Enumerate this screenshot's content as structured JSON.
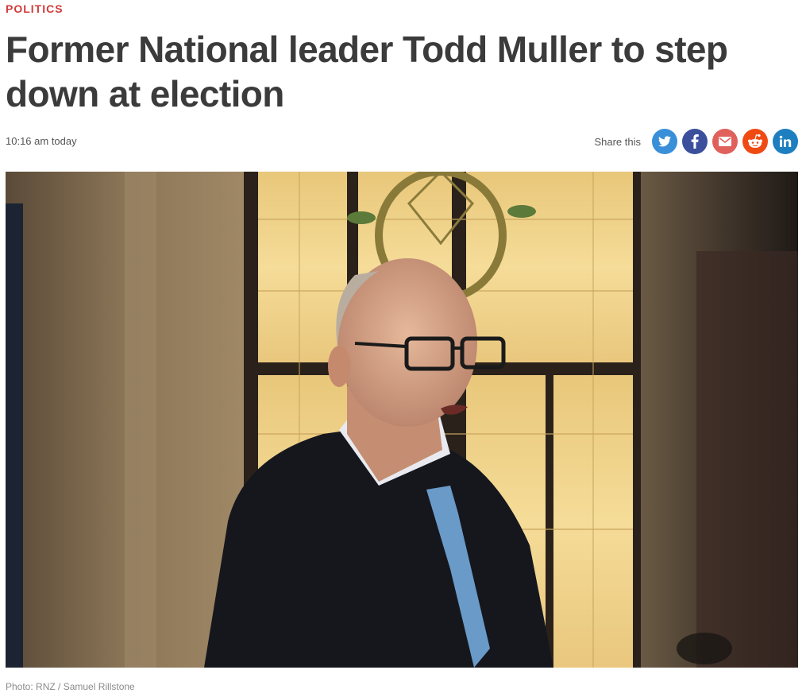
{
  "article": {
    "category": "POLITICS",
    "headline": "Former National leader Todd Muller to step down at election",
    "timestamp": "10:16 am today"
  },
  "share": {
    "label": "Share this",
    "buttons": [
      {
        "name": "twitter",
        "icon": "twitter-icon",
        "color": "#3a8fd9"
      },
      {
        "name": "facebook",
        "icon": "facebook-icon",
        "color": "#3b4f9c"
      },
      {
        "name": "email",
        "icon": "email-icon",
        "color": "#e0605c"
      },
      {
        "name": "reddit",
        "icon": "reddit-icon",
        "color": "#f04a13"
      },
      {
        "name": "linkedin",
        "icon": "linkedin-icon",
        "color": "#1d7fc0"
      }
    ]
  },
  "photo": {
    "caption": "Photo: RNZ / Samuel Rillstone"
  },
  "colors": {
    "category": "#d23a3a",
    "headline": "#3b3b3b"
  }
}
